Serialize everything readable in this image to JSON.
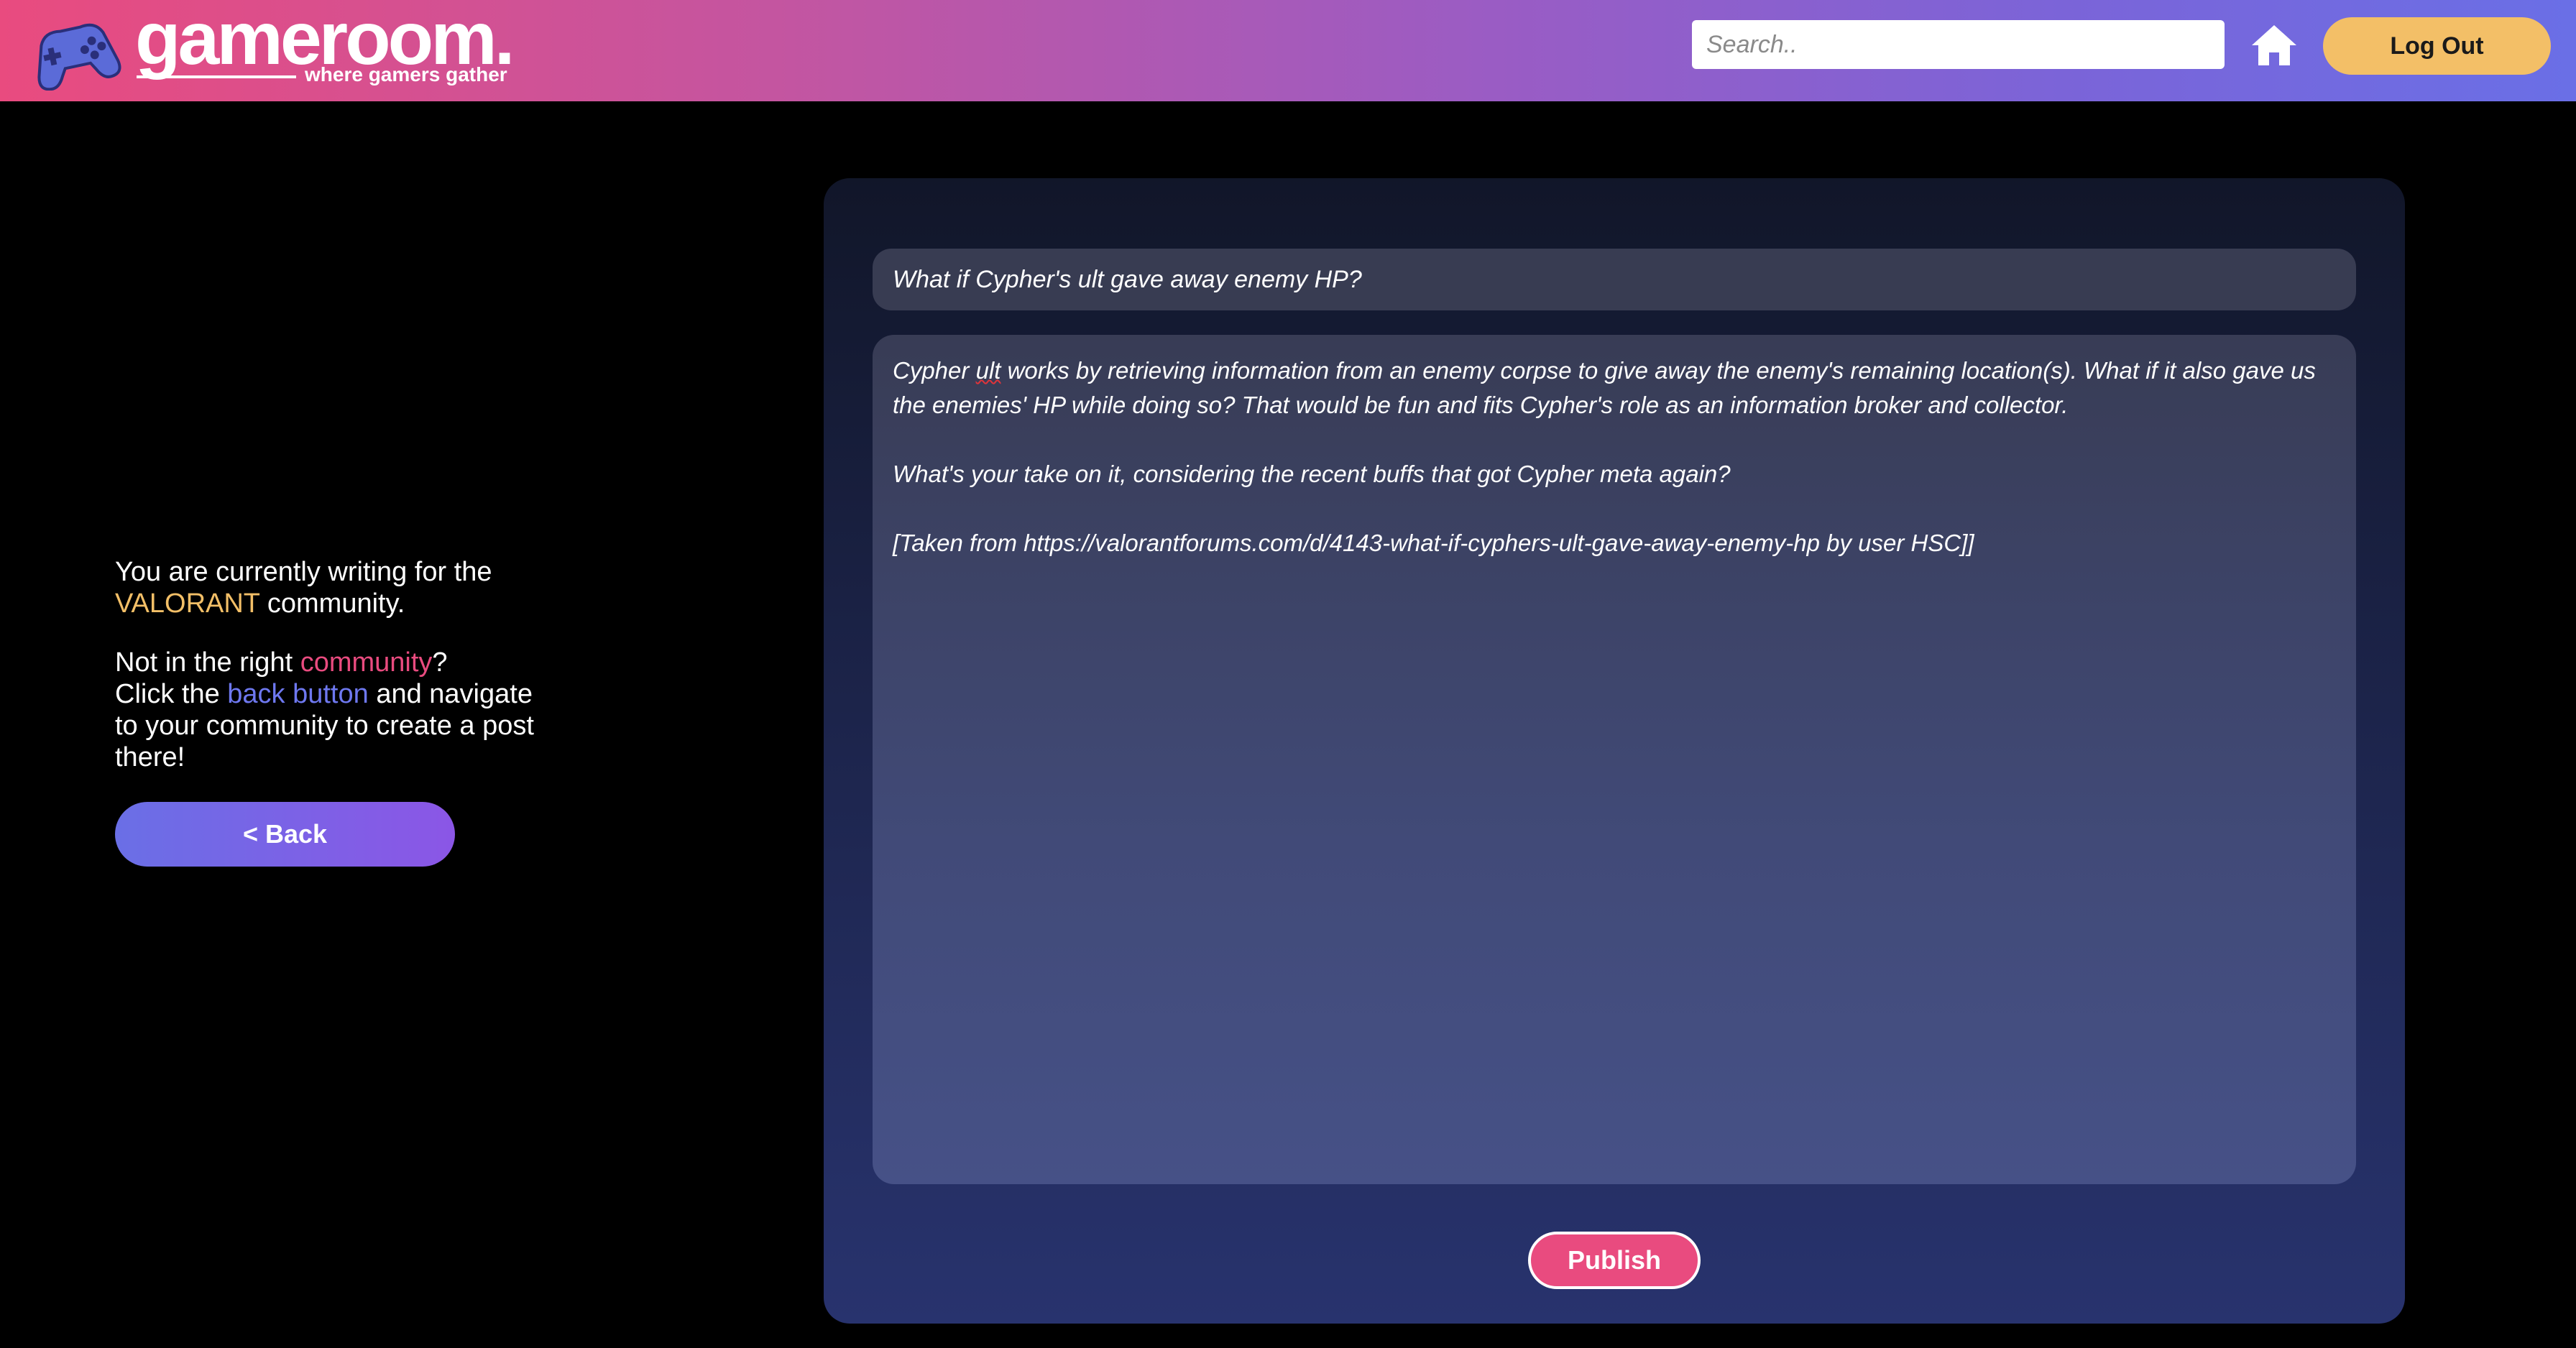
{
  "header": {
    "brand_name": "gameroom.",
    "tagline": "where gamers gather",
    "logo_icon": "gamepad-icon",
    "search_placeholder": "Search..",
    "home_icon": "home-icon",
    "logout_label": "Log Out"
  },
  "sidebar": {
    "writing_prefix": "You are currently writing for the ",
    "community_name": "VALORANT",
    "writing_suffix": " community.",
    "wrong_prefix": "Not in the right ",
    "wrong_word": "community",
    "wrong_suffix": "?",
    "click_prefix": "Click the ",
    "click_link": "back button",
    "click_suffix": " and navigate to your community to create a post there!",
    "back_label": "< Back"
  },
  "editor": {
    "title_value": "What if Cypher's ult gave away enemy HP?",
    "body_p1_a": "Cypher ",
    "body_p1_misspelled": "ult",
    "body_p1_b": " works by retrieving information from an enemy corpse to give away the enemy's remaining location(s). What if it also gave us the enemies' HP while doing so? That would be fun and fits Cypher's role as an information broker and collector.",
    "body_p2": "What's your take on it, considering the recent buffs that got Cypher meta again?",
    "body_p3": "[Taken from https://valorantforums.com/d/4143-what-if-cyphers-ult-gave-away-enemy-hp by user HSC]]",
    "publish_label": "Publish"
  },
  "colors": {
    "header_gradient_start": "#e94b7f",
    "header_gradient_end": "#6a6fe6",
    "accent_yellow": "#f3bf67",
    "accent_pink": "#e94b7f",
    "accent_blue": "#6e78f0",
    "background": "#000000"
  }
}
